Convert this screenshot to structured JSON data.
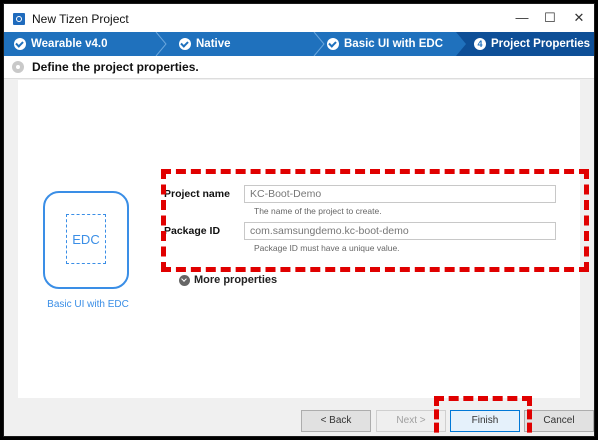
{
  "window": {
    "title": "New Tizen Project",
    "minimize_glyph": "—",
    "maximize_glyph": "☐",
    "close_glyph": "✕"
  },
  "steps": [
    {
      "label": "Wearable  v4.0",
      "state": "done"
    },
    {
      "label": "Native",
      "state": "done"
    },
    {
      "label": "Basic UI with EDC",
      "state": "done"
    },
    {
      "label": "Project Properties",
      "state": "active",
      "number": "4"
    }
  ],
  "header": {
    "text": "Define the project properties.",
    "icon": "gear-icon"
  },
  "template": {
    "tile_text": "EDC",
    "caption": "Basic UI with EDC"
  },
  "form": {
    "project_name": {
      "label": "Project name",
      "value": "KC-Boot-Demo",
      "hint": "The name of the project to create."
    },
    "package_id": {
      "label": "Package ID",
      "value": "com.samsungdemo.kc-boot-demo",
      "hint": "Package ID must have a unique value."
    }
  },
  "more_properties": "More properties",
  "buttons": {
    "back": "< Back",
    "next": "Next >",
    "finish": "Finish",
    "cancel": "Cancel"
  },
  "colors": {
    "step_bar": "#1f71bd",
    "active_step": "#0e4f97",
    "accent": "#3a8ee6",
    "annotation": "#e00000"
  }
}
